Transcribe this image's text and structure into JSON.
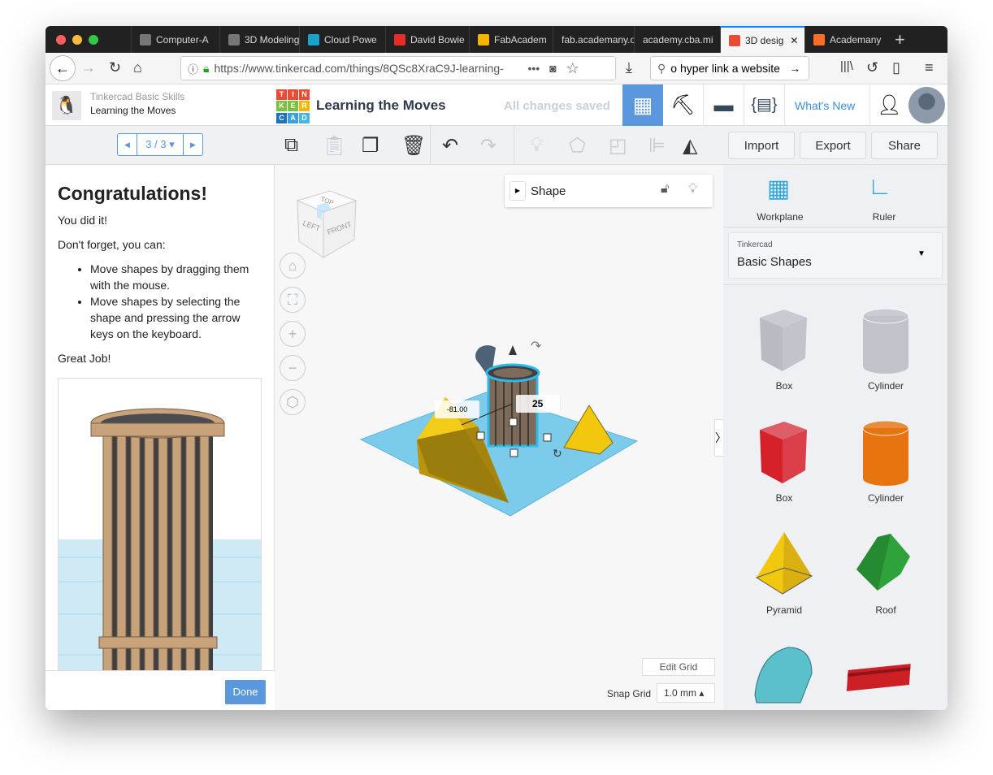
{
  "browser": {
    "tabs": [
      {
        "label": "Computer-A",
        "icon": "academany-icon"
      },
      {
        "label": "3D Modeling",
        "icon": "academany-icon"
      },
      {
        "label": "Cloud Powe",
        "icon": "autodesk-icon"
      },
      {
        "label": "David Bowie",
        "icon": "youtube-icon"
      },
      {
        "label": "FabAcadem",
        "icon": "google-drive-icon"
      },
      {
        "label": "fab.academany.o",
        "icon": ""
      },
      {
        "label": "academy.cba.mi",
        "icon": ""
      },
      {
        "label": "3D desig",
        "icon": "tinkercad-icon",
        "active": true
      },
      {
        "label": "Academany",
        "icon": "gitlab-icon"
      }
    ],
    "url": "https://www.tinkercad.com/things/8QSc8XraC9J-learning-",
    "search_value": "o hyper link a website"
  },
  "lesson": {
    "course": "Tinkercad Basic Skills",
    "title": "Learning the Moves",
    "pager": "3 / 3",
    "heading": "Congratulations!",
    "p1": "You did it!",
    "p2": "Don't forget, you can:",
    "bullets": [
      "Move shapes by dragging them with the mouse.",
      "Move shapes by selecting the shape and pressing the arrow keys on the keyboard."
    ],
    "p3": "Great Job!",
    "done": "Done"
  },
  "header": {
    "logo_letters": [
      "T",
      "I",
      "N",
      "K",
      "E",
      "R",
      "C",
      "A",
      "D"
    ],
    "design_title": "Learning the Moves",
    "save_status": "All changes saved",
    "whats_new": "What's New"
  },
  "toolbar": {
    "import": "Import",
    "export": "Export",
    "share": "Share"
  },
  "viewport": {
    "viewcube": {
      "top": "TOP",
      "left": "LEFT",
      "front": "FRONT"
    },
    "shape_panel_title": "Shape",
    "dim_x": "-81.00",
    "dim_input": "25",
    "edit_grid": "Edit Grid",
    "snap_grid_label": "Snap Grid",
    "snap_grid_value": "1.0 mm"
  },
  "right": {
    "workplane": "Workplane",
    "ruler": "Ruler",
    "library_source": "Tinkercad",
    "library_name": "Basic Shapes",
    "shapes": [
      {
        "label": "Box",
        "color": "#b8bcc2"
      },
      {
        "label": "Cylinder",
        "color": "#c0c4ca"
      },
      {
        "label": "Box",
        "color": "#d6202a"
      },
      {
        "label": "Cylinder",
        "color": "#e8740f"
      },
      {
        "label": "Pyramid",
        "color": "#f2c80f"
      },
      {
        "label": "Roof",
        "color": "#2fa23c"
      },
      {
        "label": "",
        "color": "#5bc0cc"
      },
      {
        "label": "",
        "color": "#cc1f26"
      }
    ]
  },
  "colors": {
    "accent": "#5b97dd",
    "workplane": "#7ccbeb",
    "tab_active_line": "#0a84ff"
  }
}
